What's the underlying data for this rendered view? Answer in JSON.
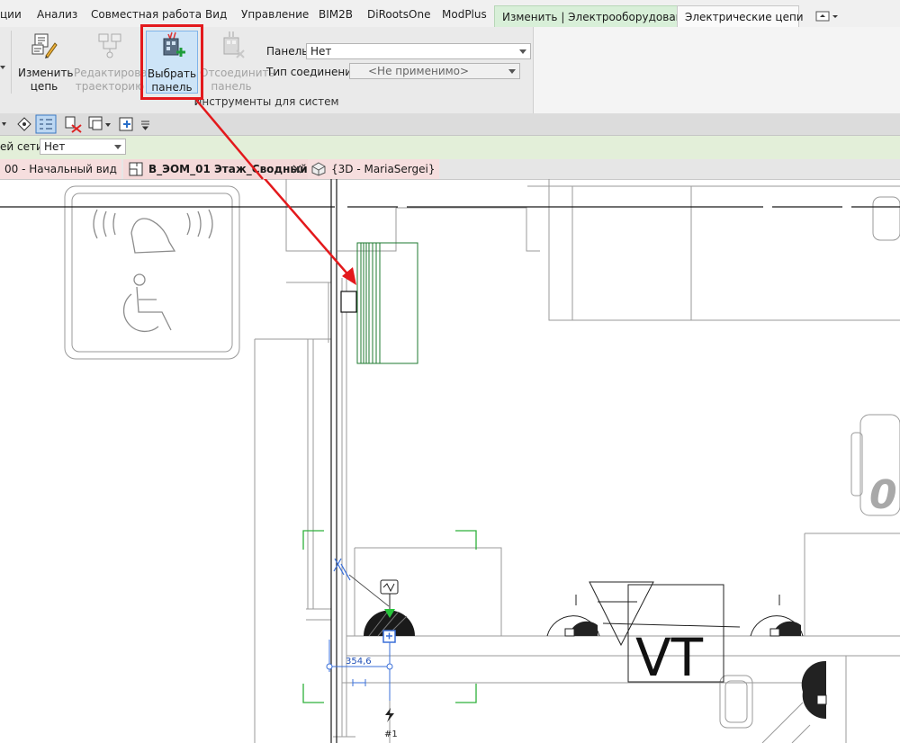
{
  "ribbon": {
    "tabs": [
      "ции",
      "Анализ",
      "Совместная работа",
      "Вид",
      "Управление",
      "BIM2B",
      "DiRootsOne",
      "ModPlus"
    ],
    "context_tabs": {
      "modify": "Изменить | Электрооборудование",
      "circuits": "Электрические цепи"
    },
    "buttons": {
      "edit_circuit": [
        "Изменить",
        "цепь"
      ],
      "edit_path": [
        "Редактировать",
        "траекторию"
      ],
      "select_panel": [
        "Выбрать",
        "панель"
      ],
      "disconnect_panel": [
        "Отсоединить",
        "панель"
      ]
    },
    "panel_title": "Инструменты для систем",
    "panel_field": {
      "label": "Панель:",
      "value": "Нет"
    },
    "connection_field": {
      "label": "Тип соединения:",
      "value": "<Не применимо>"
    }
  },
  "options_bar": {
    "label": "ей сети:",
    "value": "Нет"
  },
  "view_tabs": {
    "start": "00 - Начальный вид",
    "active": "В_ЭОМ_01 Этаж_Сводный",
    "threed": "{3D - MariaSergei}"
  },
  "drawing": {
    "dimension": "354,6",
    "circuit_number": "#1",
    "tag_text": "VT",
    "partial_text": "0"
  },
  "colors": {
    "highlight": "#e3191c",
    "accent_blue": "#3a6fd8",
    "device_green": "#1e7a2f",
    "context_green": "#d8efd8"
  }
}
